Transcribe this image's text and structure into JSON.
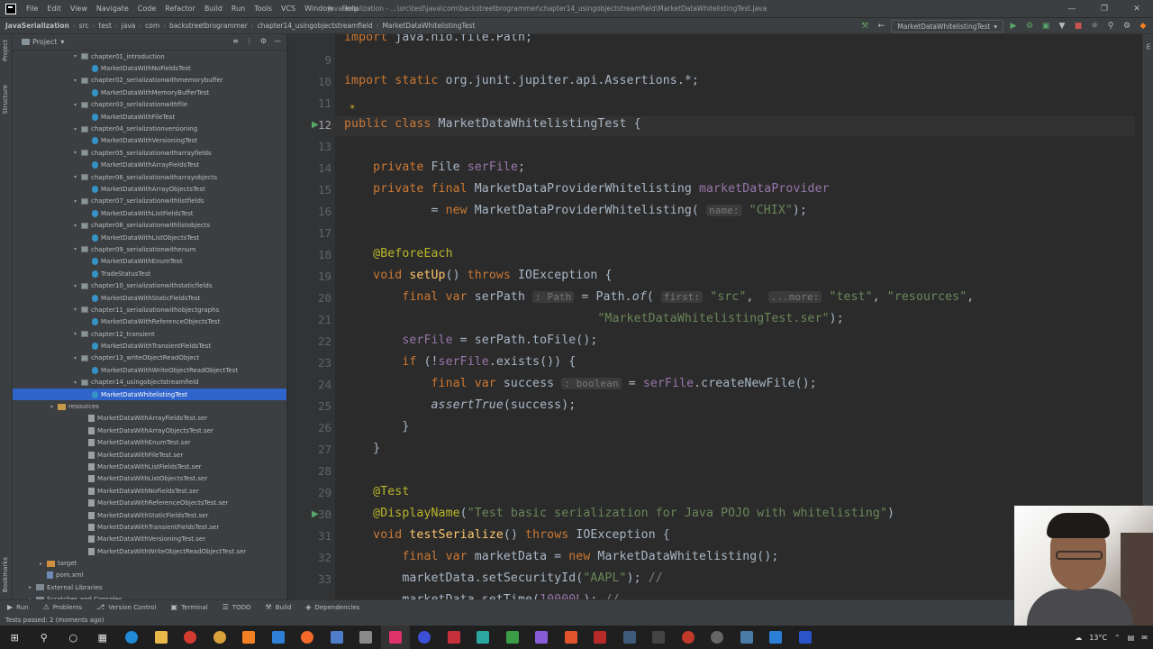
{
  "window": {
    "title": "JavaSerialization - ...\\src\\test\\java\\com\\backstreetbrogrammer\\chapter14_usingobjectstreamfield\\MarketDataWhitelistingTest.java",
    "menu": [
      "File",
      "Edit",
      "View",
      "Navigate",
      "Code",
      "Refactor",
      "Build",
      "Run",
      "Tools",
      "VCS",
      "Window",
      "Help"
    ]
  },
  "breadcrumbs": [
    "JavaSerialization",
    "src",
    "test",
    "java",
    "com",
    "backstreetbrogrammer",
    "chapter14_usingobjectstreamfield",
    "MarketDataWhitelistingTest"
  ],
  "run_config": "MarketDataWhitelistingTest",
  "project_panel": {
    "title": "Project",
    "items": [
      {
        "label": "chapter01_introduction",
        "type": "pkg",
        "indent": 0
      },
      {
        "label": "MarketDataWithNoFieldsTest",
        "type": "file",
        "indent": 1
      },
      {
        "label": "chapter02_serializationwithmemorybuffer",
        "type": "pkg",
        "indent": 0
      },
      {
        "label": "MarketDataWithMemoryBufferTest",
        "type": "file",
        "indent": 1
      },
      {
        "label": "chapter03_serializationwithfile",
        "type": "pkg",
        "indent": 0
      },
      {
        "label": "MarketDataWithFileTest",
        "type": "file",
        "indent": 1
      },
      {
        "label": "chapter04_serializationversioning",
        "type": "pkg",
        "indent": 0
      },
      {
        "label": "MarketDataWithVersioningTest",
        "type": "file",
        "indent": 1
      },
      {
        "label": "chapter05_serializationwitharrayfields",
        "type": "pkg",
        "indent": 0
      },
      {
        "label": "MarketDataWithArrayFieldsTest",
        "type": "file",
        "indent": 1
      },
      {
        "label": "chapter06_serializationwitharrayobjects",
        "type": "pkg",
        "indent": 0
      },
      {
        "label": "MarketDataWithArrayObjectsTest",
        "type": "file",
        "indent": 1
      },
      {
        "label": "chapter07_serializationwithlistfields",
        "type": "pkg",
        "indent": 0
      },
      {
        "label": "MarketDataWithListFieldsTest",
        "type": "file",
        "indent": 1
      },
      {
        "label": "chapter08_serializationwithlistobjects",
        "type": "pkg",
        "indent": 0
      },
      {
        "label": "MarketDataWithListObjectsTest",
        "type": "file",
        "indent": 1
      },
      {
        "label": "chapter09_serializationwithenum",
        "type": "pkg",
        "indent": 0
      },
      {
        "label": "MarketDataWithEnumTest",
        "type": "file",
        "indent": 1
      },
      {
        "label": "TradeStatusTest",
        "type": "file",
        "indent": 1
      },
      {
        "label": "chapter10_serializationwithstaticfields",
        "type": "pkg",
        "indent": 0
      },
      {
        "label": "MarketDataWithStaticFieldsTest",
        "type": "file",
        "indent": 1
      },
      {
        "label": "chapter11_serializationwithobjectgraphs",
        "type": "pkg",
        "indent": 0
      },
      {
        "label": "MarketDataWithReferenceObjectsTest",
        "type": "file",
        "indent": 1
      },
      {
        "label": "chapter12_transient",
        "type": "pkg",
        "indent": 0
      },
      {
        "label": "MarketDataWithTransientFieldsTest",
        "type": "file",
        "indent": 1
      },
      {
        "label": "chapter13_writeObjectReadObject",
        "type": "pkg",
        "indent": 0
      },
      {
        "label": "MarketDataWithWriteObjectReadObjectTest",
        "type": "file",
        "indent": 1
      },
      {
        "label": "chapter14_usingobjectstreamfield",
        "type": "pkg",
        "indent": 0
      },
      {
        "label": "MarketDataWhitelistingTest",
        "type": "file",
        "indent": 1,
        "selected": true
      },
      {
        "label": "resources",
        "type": "res",
        "indent": -1
      },
      {
        "label": "MarketDataWithArrayFieldsTest.ser",
        "type": "ser",
        "indent": 0
      },
      {
        "label": "MarketDataWithArrayObjectsTest.ser",
        "type": "ser",
        "indent": 0
      },
      {
        "label": "MarketDataWithEnumTest.ser",
        "type": "ser",
        "indent": 0
      },
      {
        "label": "MarketDataWithFileTest.ser",
        "type": "ser",
        "indent": 0
      },
      {
        "label": "MarketDataWithListFieldsTest.ser",
        "type": "ser",
        "indent": 0
      },
      {
        "label": "MarketDataWithListObjectsTest.ser",
        "type": "ser",
        "indent": 0
      },
      {
        "label": "MarketDataWithNoFieldsTest.ser",
        "type": "ser",
        "indent": 0
      },
      {
        "label": "MarketDataWithReferenceObjectsTest.ser",
        "type": "ser",
        "indent": 0
      },
      {
        "label": "MarketDataWithStaticFieldsTest.ser",
        "type": "ser",
        "indent": 0
      },
      {
        "label": "MarketDataWithTransientFieldsTest.ser",
        "type": "ser",
        "indent": 0
      },
      {
        "label": "MarketDataWithVersioningTest.ser",
        "type": "ser",
        "indent": 0
      },
      {
        "label": "MarketDataWithWriteObjectReadObjectTest.ser",
        "type": "ser",
        "indent": 0
      },
      {
        "label": "target",
        "type": "tgt",
        "indent": -3
      },
      {
        "label": "pom.xml",
        "type": "pom",
        "indent": -3
      },
      {
        "label": "External Libraries",
        "type": "lib",
        "indent": -4
      },
      {
        "label": "Scratches and Consoles",
        "type": "lib",
        "indent": -4
      }
    ]
  },
  "editor": {
    "current_line": 12,
    "lines": [
      {
        "n": "",
        "html": "<span class=\"kw\">import</span> java.nio.file.Path;"
      },
      {
        "n": "9",
        "html": ""
      },
      {
        "n": "10",
        "html": "<span class=\"kw\">import static</span> org.junit.jupiter.api.Assertions.*;"
      },
      {
        "n": "11",
        "html": ""
      },
      {
        "n": "12",
        "html": "<span class=\"kw\">public class</span> MarketDataWhitelistingTest {"
      },
      {
        "n": "13",
        "html": ""
      },
      {
        "n": "14",
        "html": "    <span class=\"kw\">private</span> File <span class=\"fld\">serFile</span>;"
      },
      {
        "n": "15",
        "html": "    <span class=\"kw\">private final</span> MarketDataProviderWhitelisting <span class=\"fld\">marketDataProvider</span>"
      },
      {
        "n": "16",
        "html": "            = <span class=\"kw\">new</span> MarketDataProviderWhitelisting( <span class=\"hint\">name:</span> <span class=\"str\">\"CHIX\"</span>);"
      },
      {
        "n": "17",
        "html": ""
      },
      {
        "n": "18",
        "html": "    <span class=\"ann\">@BeforeEach</span>"
      },
      {
        "n": "19",
        "html": "    <span class=\"kw\">void</span> <span class=\"mtd\">setUp</span>() <span class=\"kw\">throws</span> IOException {"
      },
      {
        "n": "20",
        "html": "        <span class=\"kw\">final var</span> serPath <span class=\"hint\">: Path</span> = Path.<span class=\"it\">of</span>( <span class=\"hint\">first:</span> <span class=\"str\">\"src\"</span>,  <span class=\"hint\">...more:</span> <span class=\"str\">\"test\"</span>, <span class=\"str\">\"resources\"</span>,"
      },
      {
        "n": "21",
        "html": "                                   <span class=\"str\">\"MarketDataWhitelistingTest.ser\"</span>);"
      },
      {
        "n": "22",
        "html": "        <span class=\"fld\">serFile</span> = serPath.toFile();"
      },
      {
        "n": "23",
        "html": "        <span class=\"kw\">if</span> (!<span class=\"fld\">serFile</span>.exists()) {"
      },
      {
        "n": "24",
        "html": "            <span class=\"kw\">final var</span> success <span class=\"hint\">: boolean</span> = <span class=\"fld\">serFile</span>.createNewFile();"
      },
      {
        "n": "25",
        "html": "            <span class=\"it\">assertTrue</span>(success);"
      },
      {
        "n": "26",
        "html": "        }"
      },
      {
        "n": "27",
        "html": "    }"
      },
      {
        "n": "28",
        "html": ""
      },
      {
        "n": "29",
        "html": "    <span class=\"ann\">@Test</span>"
      },
      {
        "n": "30",
        "html": "    <span class=\"ann\">@DisplayName</span>(<span class=\"str\">\"Test basic serialization for Java POJO with whitelisting\"</span>)"
      },
      {
        "n": "31",
        "html": "    <span class=\"kw\">void</span> <span class=\"mtd\">testSerialize</span>() <span class=\"kw\">throws</span> IOException {"
      },
      {
        "n": "32",
        "html": "        <span class=\"kw\">final var</span> marketData = <span class=\"kw\">new</span> MarketDataWhitelisting();"
      },
      {
        "n": "33",
        "html": "        marketData.setSecurityId(<span class=\"str\">\"AAPL\"</span>); <span class=\"cmt\">//</span>"
      },
      {
        "n": "",
        "html": "        marketData.setTime(<span class=\"fld\">10000L</span>); <span class=\"cmt\">//</span>"
      }
    ]
  },
  "bottom_tools": [
    "Run",
    "Problems",
    "Version Control",
    "Terminal",
    "TODO",
    "Build",
    "Dependencies"
  ],
  "status": "Tests passed: 2 (moments ago)",
  "tray": {
    "temp": "13°C"
  },
  "left_tabs": [
    "Project",
    "Structure",
    "Bookmarks"
  ]
}
